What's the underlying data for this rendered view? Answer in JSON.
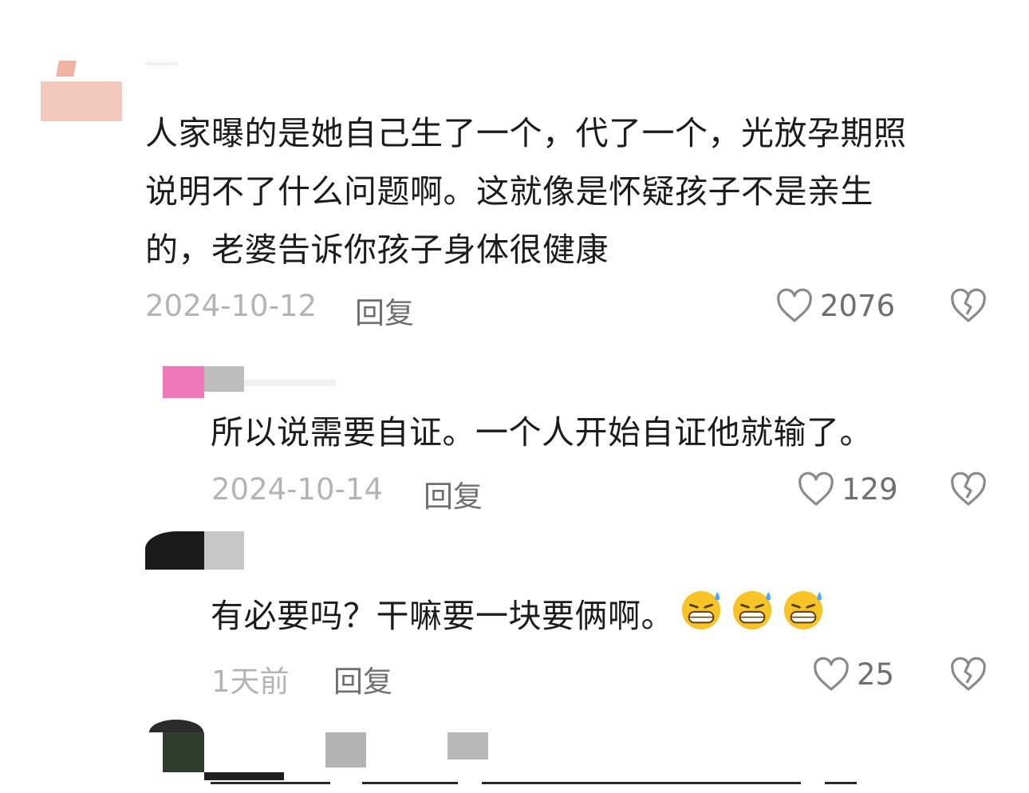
{
  "colors": {
    "text": "#1c1c1c",
    "date": "#b4b4b4",
    "action": "#6f6f6f",
    "icon": "#8a8a8a"
  },
  "comments": [
    {
      "date": "2024-10-12",
      "reply_label": "回复",
      "likes": "2076",
      "lines": [
        "人家曝的是她自己生了一个，代了一个，光放孕期照",
        "说明不了什么问题啊。这就像是怀疑孩子不是亲生",
        "的，老婆告诉你孩子身体很健康"
      ],
      "icons": [
        "heart-outline-icon",
        "broken-heart-icon"
      ]
    },
    {
      "date": "2024-10-14",
      "reply_label": "回复",
      "likes": "129",
      "lines": [
        "所以说需要自证。一个人开始自证他就输了。"
      ],
      "icons": [
        "heart-outline-icon",
        "broken-heart-icon"
      ]
    },
    {
      "date": "1天前",
      "reply_label": "回复",
      "likes": "25",
      "lines": [
        "有必要吗？干嘛要一块要俩啊。"
      ],
      "emojis": [
        "grinning-sweat-emoji",
        "grinning-sweat-emoji",
        "grinning-sweat-emoji"
      ],
      "icons": [
        "heart-outline-icon",
        "broken-heart-icon"
      ]
    }
  ]
}
